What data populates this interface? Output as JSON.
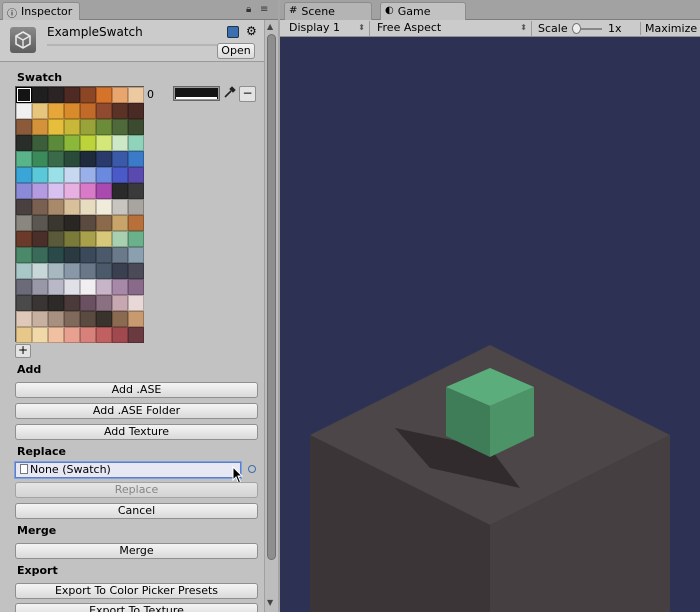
{
  "inspector": {
    "tab_label": "Inspector",
    "object_name": "ExampleSwatch",
    "open_label": "Open"
  },
  "swatch": {
    "heading": "Swatch",
    "selected_index": "0",
    "selected_color": "#151515",
    "colors": [
      "#141414",
      "#1f1f1f",
      "#2c2424",
      "#4e2a23",
      "#8a4625",
      "#d6732b",
      "#e9a56e",
      "#edc9a2",
      "#f0f0f0",
      "#e8c57c",
      "#e6a63a",
      "#d98a2a",
      "#c26a2a",
      "#8f4a2f",
      "#5a3226",
      "#4a2a25",
      "#8a5a3a",
      "#d4933a",
      "#e7be3b",
      "#c9b73a",
      "#9aa33a",
      "#6c8c3a",
      "#4e6a3a",
      "#3c4a30",
      "#2a2e2a",
      "#3c5e3a",
      "#5a8a3a",
      "#8cb83a",
      "#bcd33a",
      "#d4e87a",
      "#cde8c6",
      "#8fd3bb",
      "#5ab48a",
      "#3a8a5a",
      "#3a6a4a",
      "#2a4a3a",
      "#1f2a3a",
      "#2a3a6a",
      "#3a5aa8",
      "#3a7ac8",
      "#3aa6d8",
      "#5ac8d8",
      "#9ae0e8",
      "#c8d8f0",
      "#9ab0e8",
      "#6a8ae0",
      "#4a5ac8",
      "#5a4ab0",
      "#8a8ad8",
      "#b49ae0",
      "#d8c0f0",
      "#e8b0e0",
      "#d87ac8",
      "#a84ab0",
      "#2a2a2a",
      "#3a3a3a",
      "#4a4040",
      "#7a6050",
      "#a88a6a",
      "#d8c09a",
      "#e8dcc0",
      "#f0ecdc",
      "#c8c4c0",
      "#a8a4a0",
      "#8a8680",
      "#5a5650",
      "#3a3630",
      "#2a2624",
      "#5a4a40",
      "#8a6a4a",
      "#c8a46a",
      "#b8703a",
      "#6a3a2a",
      "#4a2e2a",
      "#5a5a3a",
      "#7a7a3a",
      "#a8a04a",
      "#d8c87a",
      "#a8d0b0",
      "#6ab08a",
      "#4a8a6a",
      "#3a6a5a",
      "#2a4a4a",
      "#2a3a40",
      "#3a4a5a",
      "#4a5a6a",
      "#6a7a8a",
      "#8aa0b0",
      "#a8c8c8",
      "#c8d8d8",
      "#a8b8c0",
      "#8898a8",
      "#687888",
      "#4a5a6a",
      "#3a4050",
      "#4a4a58",
      "#6a6a78",
      "#9898a8",
      "#b8b8c8",
      "#e0e0e8",
      "#f0eef0",
      "#c8b4c8",
      "#a888a8",
      "#8a6a8a",
      "#4a4a4a",
      "#3a3434",
      "#2e2a2a",
      "#4a3a3a",
      "#6a5060",
      "#8a7080",
      "#c8a8b0",
      "#e8d8d8",
      "#e0c8b8",
      "#c8b0a0",
      "#a89080",
      "#80685a",
      "#5a4a40",
      "#3a322c",
      "#8a6a50",
      "#c89a70",
      "#e8c88a",
      "#f0d8a8",
      "#f0c0a0",
      "#e8a090",
      "#d8807a",
      "#c06060",
      "#a04a50",
      "#6a3a40"
    ],
    "add_cell_label": "+"
  },
  "add": {
    "heading": "Add",
    "add_ase": "Add .ASE",
    "add_ase_folder": "Add .ASE Folder",
    "add_texture": "Add Texture"
  },
  "replace": {
    "heading": "Replace",
    "field_value": "None (Swatch)",
    "replace_label": "Replace",
    "cancel_label": "Cancel"
  },
  "merge": {
    "heading": "Merge",
    "merge_label": "Merge"
  },
  "export": {
    "heading": "Export",
    "to_presets": "Export To Color Picker Presets",
    "to_texture": "Export To Texture"
  },
  "game": {
    "scene_tab": "Scene",
    "game_tab": "Game",
    "display": "Display 1",
    "aspect": "Free Aspect",
    "scale_label": "Scale",
    "scale_value": "1x",
    "maximize_label": "Maximize On Play",
    "background_color": "#2d3255",
    "cube_color": "#5bae7c"
  }
}
